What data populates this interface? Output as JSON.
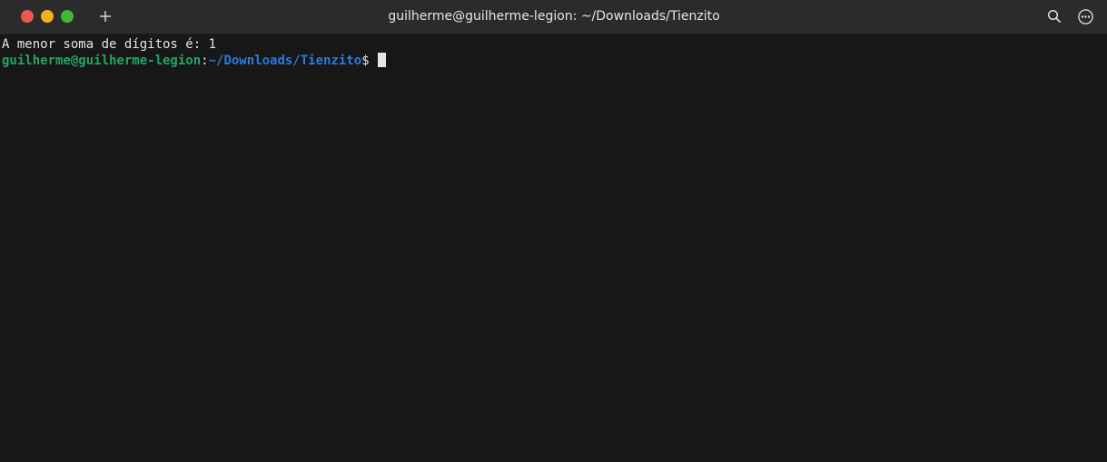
{
  "window": {
    "title": "guilherme@guilherme-legion: ~/Downloads/Tienzito"
  },
  "titlebar": {
    "icons": [
      "close-icon",
      "minimize-icon",
      "maximize-icon",
      "plus-icon",
      "search-icon",
      "menu-icon"
    ]
  },
  "terminal": {
    "output_line": "A menor soma de dígitos é: 1",
    "prompt": {
      "user_host": "guilherme@guilherme-legion",
      "separator": ":",
      "path": "~/Downloads/Tienzito",
      "symbol": "$"
    }
  },
  "colors": {
    "background": "#171717",
    "titlebar": "#2b2b2b",
    "text": "#e5e5e5",
    "prompt_user": "#26a269",
    "prompt_path": "#2a7bde",
    "close": "#ed5750",
    "minimize": "#f2b01c",
    "maximize": "#3fb837"
  }
}
